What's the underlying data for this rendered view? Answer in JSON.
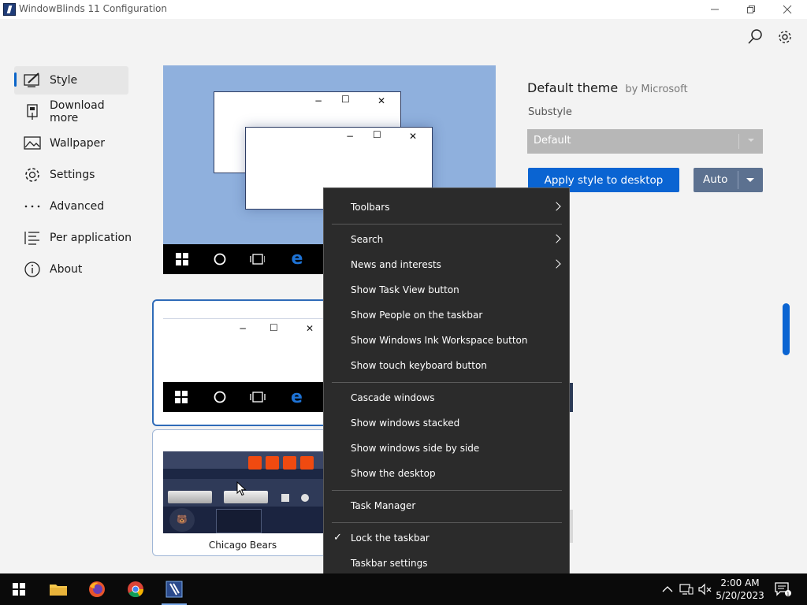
{
  "window": {
    "title": "WindowBlinds 11 Configuration",
    "controls": [
      "minimize",
      "restore",
      "close"
    ]
  },
  "toolbar": {
    "icons": [
      "search-icon",
      "settings-gear-icon"
    ]
  },
  "sidebar": {
    "items": [
      {
        "label": "Style",
        "icon": "style-brush-icon",
        "active": true
      },
      {
        "label": "Download more",
        "icon": "download-icon",
        "active": false
      },
      {
        "label": "Wallpaper",
        "icon": "picture-icon",
        "active": false
      },
      {
        "label": "Settings",
        "icon": "gear-icon",
        "active": false
      },
      {
        "label": "Advanced",
        "icon": "dots-icon",
        "active": false
      },
      {
        "label": "Per application",
        "icon": "list-icon",
        "active": false
      },
      {
        "label": "About",
        "icon": "info-icon",
        "active": false
      }
    ]
  },
  "theme": {
    "name": "Default theme",
    "by": "by Microsoft",
    "substyle_label": "Substyle",
    "substyle_value": "Default",
    "apply_label": "Apply style to desktop",
    "auto_label": "Auto"
  },
  "cards": [
    {
      "label": ""
    },
    {
      "label": "Chicago Bears"
    }
  ],
  "context_menu": {
    "groups": [
      [
        {
          "label": "Toolbars",
          "submenu": true
        }
      ],
      [
        {
          "label": "Search",
          "submenu": true
        },
        {
          "label": "News and interests",
          "submenu": true
        },
        {
          "label": "Show Task View button",
          "submenu": false
        },
        {
          "label": "Show People on the taskbar",
          "submenu": false
        },
        {
          "label": "Show Windows Ink Workspace button",
          "submenu": false
        },
        {
          "label": "Show touch keyboard button",
          "submenu": false
        }
      ],
      [
        {
          "label": "Cascade windows",
          "submenu": false
        },
        {
          "label": "Show windows stacked",
          "submenu": false
        },
        {
          "label": "Show windows side by side",
          "submenu": false
        },
        {
          "label": "Show the desktop",
          "submenu": false
        }
      ],
      [
        {
          "label": "Task Manager",
          "submenu": false
        }
      ],
      [
        {
          "label": "Lock the taskbar",
          "checked": true
        },
        {
          "label": "Taskbar settings",
          "submenu": false
        }
      ]
    ]
  },
  "taskbar": {
    "apps": [
      "start-icon",
      "file-explorer-icon",
      "firefox-icon",
      "chrome-icon",
      "windowblinds-icon"
    ],
    "tray": [
      "chevron-up-icon",
      "network-icon",
      "volume-muted-icon"
    ],
    "time": "2:00 AM",
    "date": "5/20/2023"
  },
  "colors": {
    "accent": "#0a64d2",
    "menu_bg": "#2b2b2b",
    "preview_bg": "#8fb0dd"
  }
}
